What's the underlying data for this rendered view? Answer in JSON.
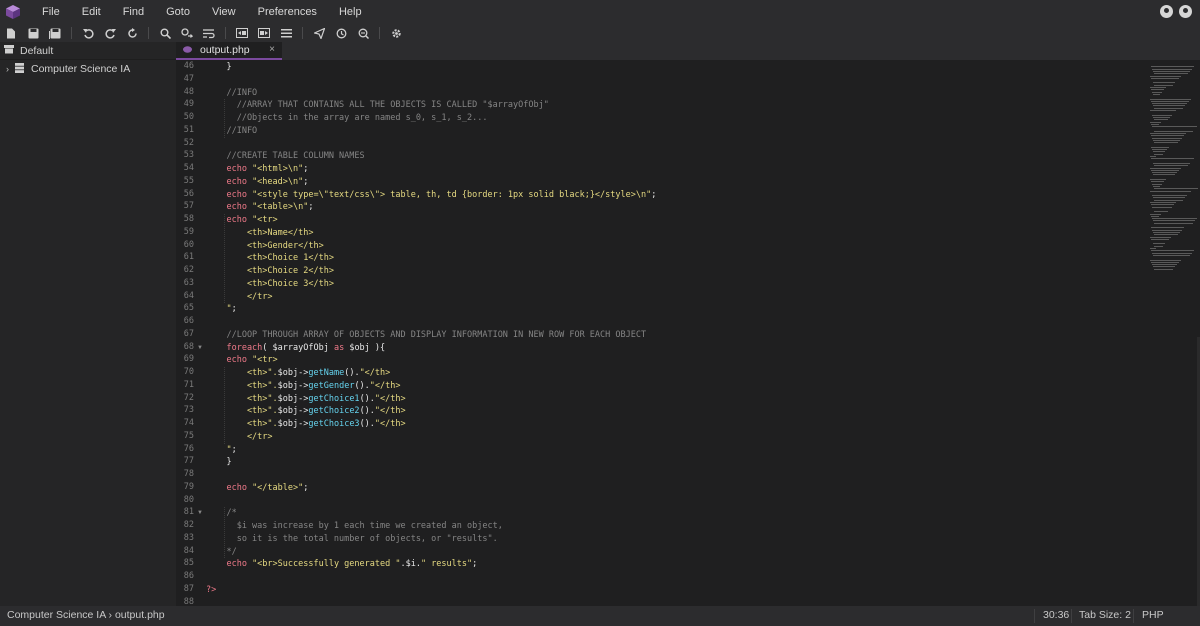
{
  "menu": {
    "items": [
      "File",
      "Edit",
      "Find",
      "Goto",
      "View",
      "Preferences",
      "Help"
    ]
  },
  "toolbar": {
    "buttons": [
      {
        "icon": "new-file-icon"
      },
      {
        "icon": "save-icon"
      },
      {
        "icon": "save-all-icon"
      },
      {
        "icon": "undo-icon"
      },
      {
        "icon": "redo-icon"
      },
      {
        "icon": "revert-icon"
      },
      {
        "icon": "search-icon"
      },
      {
        "icon": "find-replace-icon"
      },
      {
        "icon": "word-wrap-icon"
      },
      {
        "icon": "indent-left-icon"
      },
      {
        "icon": "indent-right-icon"
      },
      {
        "icon": "toggle-panel-icon"
      },
      {
        "icon": "send-icon"
      },
      {
        "icon": "history-icon"
      },
      {
        "icon": "zoom-icon"
      },
      {
        "icon": "settings-icon"
      }
    ]
  },
  "sidebar": {
    "header": "Default",
    "tree": [
      {
        "label": "Computer Science IA"
      }
    ]
  },
  "tabs": [
    {
      "label": "output.php",
      "close": "×"
    }
  ],
  "editor": {
    "first_line": 46,
    "lines": [
      [
        {
          "t": "    }",
          "c": "text"
        }
      ],
      [],
      [
        {
          "t": "    //INFO",
          "c": "cmt"
        }
      ],
      [
        {
          "t": "      //ARRAY THAT CONTAINS ALL THE OBJECTS IS CALLED \"$arrayOfObj\"",
          "c": "cmt"
        }
      ],
      [
        {
          "t": "      //Objects in the array are named s_0, s_1, s_2...",
          "c": "cmt"
        }
      ],
      [
        {
          "t": "    //INFO",
          "c": "cmt"
        }
      ],
      [],
      [
        {
          "t": "    //CREATE TABLE COLUMN NAMES",
          "c": "cmt"
        }
      ],
      [
        {
          "t": "    echo ",
          "c": "kw"
        },
        {
          "t": "\"<html>\\n\"",
          "c": "str"
        },
        {
          "t": ";",
          "c": "text"
        }
      ],
      [
        {
          "t": "    echo ",
          "c": "kw"
        },
        {
          "t": "\"<head>\\n\"",
          "c": "str"
        },
        {
          "t": ";",
          "c": "text"
        }
      ],
      [
        {
          "t": "    echo ",
          "c": "kw"
        },
        {
          "t": "\"<style type=\\\"text/css\\\"> table, th, td {border: 1px solid black;}</style>\\n\"",
          "c": "str"
        },
        {
          "t": ";",
          "c": "text"
        }
      ],
      [
        {
          "t": "    echo ",
          "c": "kw"
        },
        {
          "t": "\"<table>\\n\"",
          "c": "str"
        },
        {
          "t": ";",
          "c": "text"
        }
      ],
      [
        {
          "t": "    echo ",
          "c": "kw"
        },
        {
          "t": "\"<tr>",
          "c": "str"
        }
      ],
      [
        {
          "t": "        <th>Name</th>",
          "c": "str"
        }
      ],
      [
        {
          "t": "        <th>Gender</th>",
          "c": "str"
        }
      ],
      [
        {
          "t": "        <th>Choice 1</th>",
          "c": "str"
        }
      ],
      [
        {
          "t": "        <th>Choice 2</th>",
          "c": "str"
        }
      ],
      [
        {
          "t": "        <th>Choice 3</th>",
          "c": "str"
        }
      ],
      [
        {
          "t": "        </tr>",
          "c": "str"
        }
      ],
      [
        {
          "t": "    \"",
          "c": "str"
        },
        {
          "t": ";",
          "c": "text"
        }
      ],
      [],
      [
        {
          "t": "    //LOOP THROUGH ARRAY OF OBJECTS AND DISPLAY INFORMATION IN NEW ROW FOR EACH OBJECT",
          "c": "cmt"
        }
      ],
      [
        {
          "t": "    foreach",
          "c": "kw"
        },
        {
          "t": "( $arrayOfObj ",
          "c": "text"
        },
        {
          "t": "as",
          "c": "kw"
        },
        {
          "t": " $obj ){",
          "c": "text"
        }
      ],
      [
        {
          "t": "    echo ",
          "c": "kw"
        },
        {
          "t": "\"<tr>",
          "c": "str"
        }
      ],
      [
        {
          "t": "        <th>\".",
          "c": "str"
        },
        {
          "t": "$obj->",
          "c": "text"
        },
        {
          "t": "getName",
          "c": "fn"
        },
        {
          "t": "().",
          "c": "text"
        },
        {
          "t": "\"</th>",
          "c": "str"
        }
      ],
      [
        {
          "t": "        <th>\".",
          "c": "str"
        },
        {
          "t": "$obj->",
          "c": "text"
        },
        {
          "t": "getGender",
          "c": "fn"
        },
        {
          "t": "().",
          "c": "text"
        },
        {
          "t": "\"</th>",
          "c": "str"
        }
      ],
      [
        {
          "t": "        <th>\".",
          "c": "str"
        },
        {
          "t": "$obj->",
          "c": "text"
        },
        {
          "t": "getChoice1",
          "c": "fn"
        },
        {
          "t": "().",
          "c": "text"
        },
        {
          "t": "\"</th>",
          "c": "str"
        }
      ],
      [
        {
          "t": "        <th>\".",
          "c": "str"
        },
        {
          "t": "$obj->",
          "c": "text"
        },
        {
          "t": "getChoice2",
          "c": "fn"
        },
        {
          "t": "().",
          "c": "text"
        },
        {
          "t": "\"</th>",
          "c": "str"
        }
      ],
      [
        {
          "t": "        <th>\".",
          "c": "str"
        },
        {
          "t": "$obj->",
          "c": "text"
        },
        {
          "t": "getChoice3",
          "c": "fn"
        },
        {
          "t": "().",
          "c": "text"
        },
        {
          "t": "\"</th>",
          "c": "str"
        }
      ],
      [
        {
          "t": "        </tr>",
          "c": "str"
        }
      ],
      [
        {
          "t": "    \"",
          "c": "str"
        },
        {
          "t": ";",
          "c": "text"
        }
      ],
      [
        {
          "t": "    }",
          "c": "text"
        }
      ],
      [],
      [
        {
          "t": "    echo ",
          "c": "kw"
        },
        {
          "t": "\"</table>\"",
          "c": "str"
        },
        {
          "t": ";",
          "c": "text"
        }
      ],
      [],
      [
        {
          "t": "    /*",
          "c": "cmt"
        }
      ],
      [
        {
          "t": "      $i was increase by 1 each time we created an object,",
          "c": "cmt"
        }
      ],
      [
        {
          "t": "      so it is the total number of objects, or \"results\".",
          "c": "cmt"
        }
      ],
      [
        {
          "t": "    */",
          "c": "cmt"
        }
      ],
      [
        {
          "t": "    echo ",
          "c": "kw"
        },
        {
          "t": "\"<br>Successfully generated \"",
          "c": "str"
        },
        {
          "t": ".$i.",
          "c": "text"
        },
        {
          "t": "\" results\"",
          "c": "str"
        },
        {
          "t": ";",
          "c": "text"
        }
      ],
      [],
      [
        {
          "t": "?>",
          "c": "kw"
        }
      ],
      []
    ],
    "fold_lines": [
      68,
      81
    ]
  },
  "statusbar": {
    "path": "Computer Science IA › output.php",
    "cursor": "30:36",
    "tab_size": "Tab Size: 2",
    "language": "PHP"
  },
  "colors": {
    "accent": "#7b4a9e",
    "keyword": "#f07a8a",
    "string": "#e6da82",
    "comment": "#858585",
    "function": "#65d3ee"
  }
}
